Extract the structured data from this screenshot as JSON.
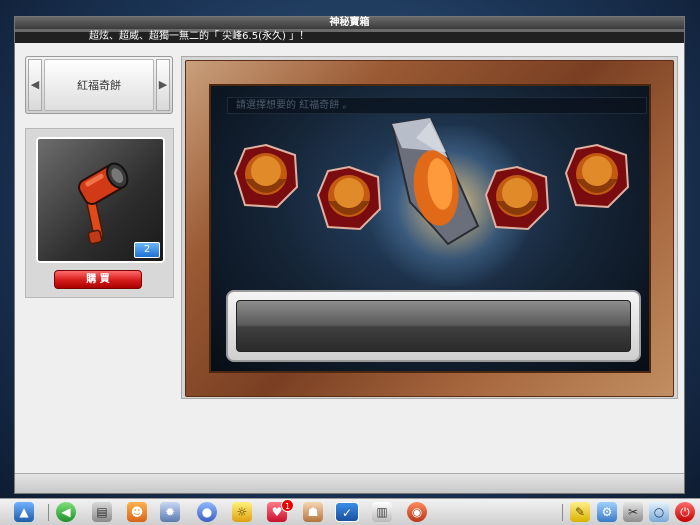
{
  "window": {
    "title": "神秘寶箱",
    "announcement": "超炫、超威、超獨一無二的「 尖峰6.5(永久) 」！"
  },
  "selector": {
    "current": "紅福奇餅"
  },
  "item": {
    "quantity": "2",
    "buy_label": "購 買"
  },
  "main": {
    "prompt": "請選擇想要的 紅福奇餅 。"
  },
  "taskbar": {
    "icons": [
      "maplestory-logo-icon",
      "back-arrow-icon",
      "shop-cart-icon",
      "character-icon",
      "skill-gears-icon",
      "quest-icon",
      "pet-icon",
      "heart-icon",
      "party-icon",
      "inventory-icon",
      "book-icon",
      "event-icon",
      "notepad-icon",
      "settings-icon",
      "tools-icon",
      "search-icon",
      "power-icon"
    ],
    "notification_count": "1"
  },
  "colors": {
    "buy_button": "#d61a1a",
    "quantity_badge": "#1f6fd1",
    "frame_wood": "#9a5a34"
  }
}
